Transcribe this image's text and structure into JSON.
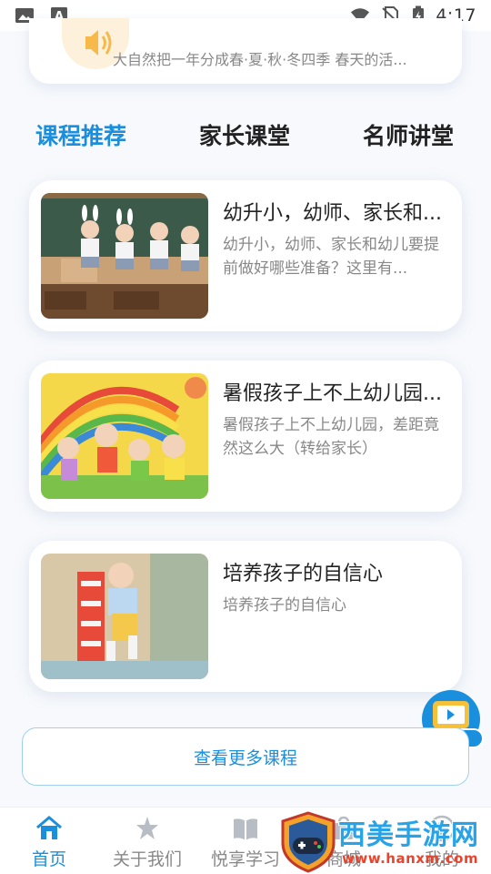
{
  "status_bar": {
    "time": "4:17",
    "left_icons": [
      "image-icon",
      "text-a-icon"
    ],
    "right_icons": [
      "wifi-icon",
      "no-sim-icon",
      "battery-charging-icon"
    ]
  },
  "audio_card": {
    "icon": "speaker-icon",
    "description": "大自然把一年分成春·夏·秋·冬四季 春天的活..."
  },
  "tabs": [
    {
      "label": "课程推荐",
      "active": true
    },
    {
      "label": "家长课堂",
      "active": false
    },
    {
      "label": "名师讲堂",
      "active": false
    }
  ],
  "courses": [
    {
      "title": "幼升小，幼师、家长和...",
      "description": "幼升小，幼师、家长和幼儿要提前做好哪些准备？这里有..."
    },
    {
      "title": "暑假孩子上不上幼儿园...",
      "description": "暑假孩子上不上幼儿园，差距竟然这么大（转给家长）"
    },
    {
      "title": "培养孩子的自信心",
      "description": "培养孩子的自信心"
    }
  ],
  "more_button": {
    "label": "查看更多课程"
  },
  "live_badge": {
    "label": "直播"
  },
  "bottom_nav": [
    {
      "label": "首页",
      "icon": "home-icon",
      "active": true
    },
    {
      "label": "关于我们",
      "icon": "star-person-icon",
      "active": false
    },
    {
      "label": "悦享学习",
      "icon": "book-icon",
      "active": false
    },
    {
      "label": "商城",
      "icon": "shop-icon",
      "active": false
    },
    {
      "label": "我的",
      "icon": "profile-icon",
      "active": false
    }
  ],
  "watermark": {
    "text": "西美手游网",
    "url": "www.hanxm.com"
  },
  "colors": {
    "accent": "#1a8fde",
    "muted_text": "#888888",
    "title_text": "#222222",
    "card_bg": "#ffffff",
    "page_bg": "#f7f9fc"
  }
}
